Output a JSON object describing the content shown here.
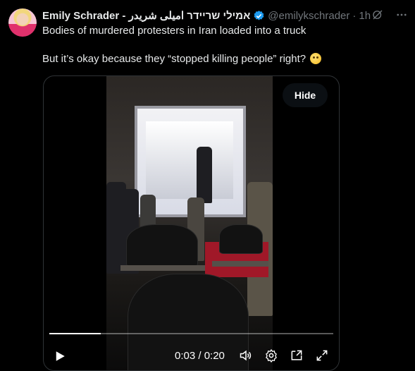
{
  "tweet": {
    "author_name": "Emily Schrader - אמילי שריידר امیلی شریدر",
    "handle": "@emilykschrader",
    "separator": "·",
    "time": "1h",
    "text_line1": "Bodies of murdered protesters in Iran loaded into a truck",
    "text_line2": "But it’s okay because they “stopped killing people” right?",
    "icons": [
      "grok-icon",
      "more-icon"
    ]
  },
  "media": {
    "hide_label": "Hide",
    "time_display": "0:03 / 0:20",
    "progress": 0.18,
    "controls": [
      "play-icon",
      "volume-icon",
      "settings-icon",
      "pip-icon",
      "fullscreen-icon"
    ]
  },
  "colors": {
    "verified": "#1d9bf0",
    "secondary_text": "#71767b"
  }
}
